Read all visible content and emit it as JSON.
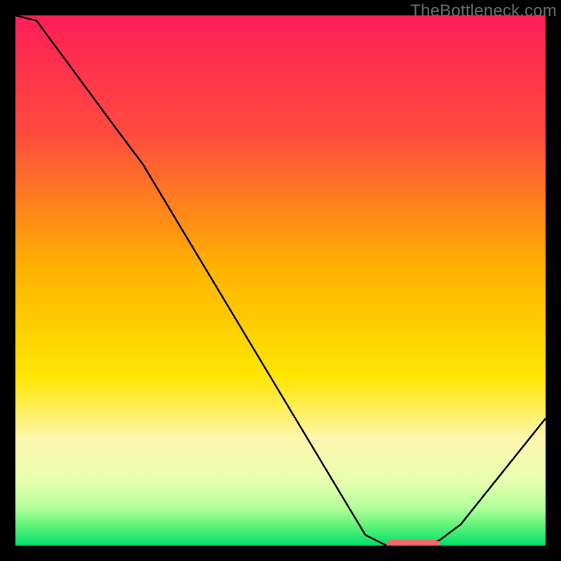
{
  "watermark": "TheBottleneck.com",
  "chart_data": {
    "type": "line",
    "title": "",
    "xlabel": "",
    "ylabel": "",
    "xlim": [
      0,
      100
    ],
    "ylim": [
      0,
      100
    ],
    "gradient_stops": [
      {
        "offset": 0,
        "color": "#ff1e58"
      },
      {
        "offset": 22,
        "color": "#ff4a3f"
      },
      {
        "offset": 48,
        "color": "#ffb300"
      },
      {
        "offset": 68,
        "color": "#ffe600"
      },
      {
        "offset": 80,
        "color": "#fff6b0"
      },
      {
        "offset": 88,
        "color": "#e6ffb0"
      },
      {
        "offset": 93,
        "color": "#b0ff99"
      },
      {
        "offset": 96,
        "color": "#66f47a"
      },
      {
        "offset": 100,
        "color": "#00e06a"
      }
    ],
    "series": [
      {
        "name": "bottleneck-curve",
        "x": [
          0,
          4,
          18,
          24,
          66,
          70,
          76,
          80,
          84,
          100
        ],
        "y": [
          100,
          99,
          80,
          72,
          2,
          0,
          0,
          1,
          4,
          24
        ]
      }
    ],
    "marker": {
      "name": "optimal-range",
      "x_start": 70,
      "x_end": 80,
      "y": 0,
      "color": "#f46a6a"
    }
  }
}
